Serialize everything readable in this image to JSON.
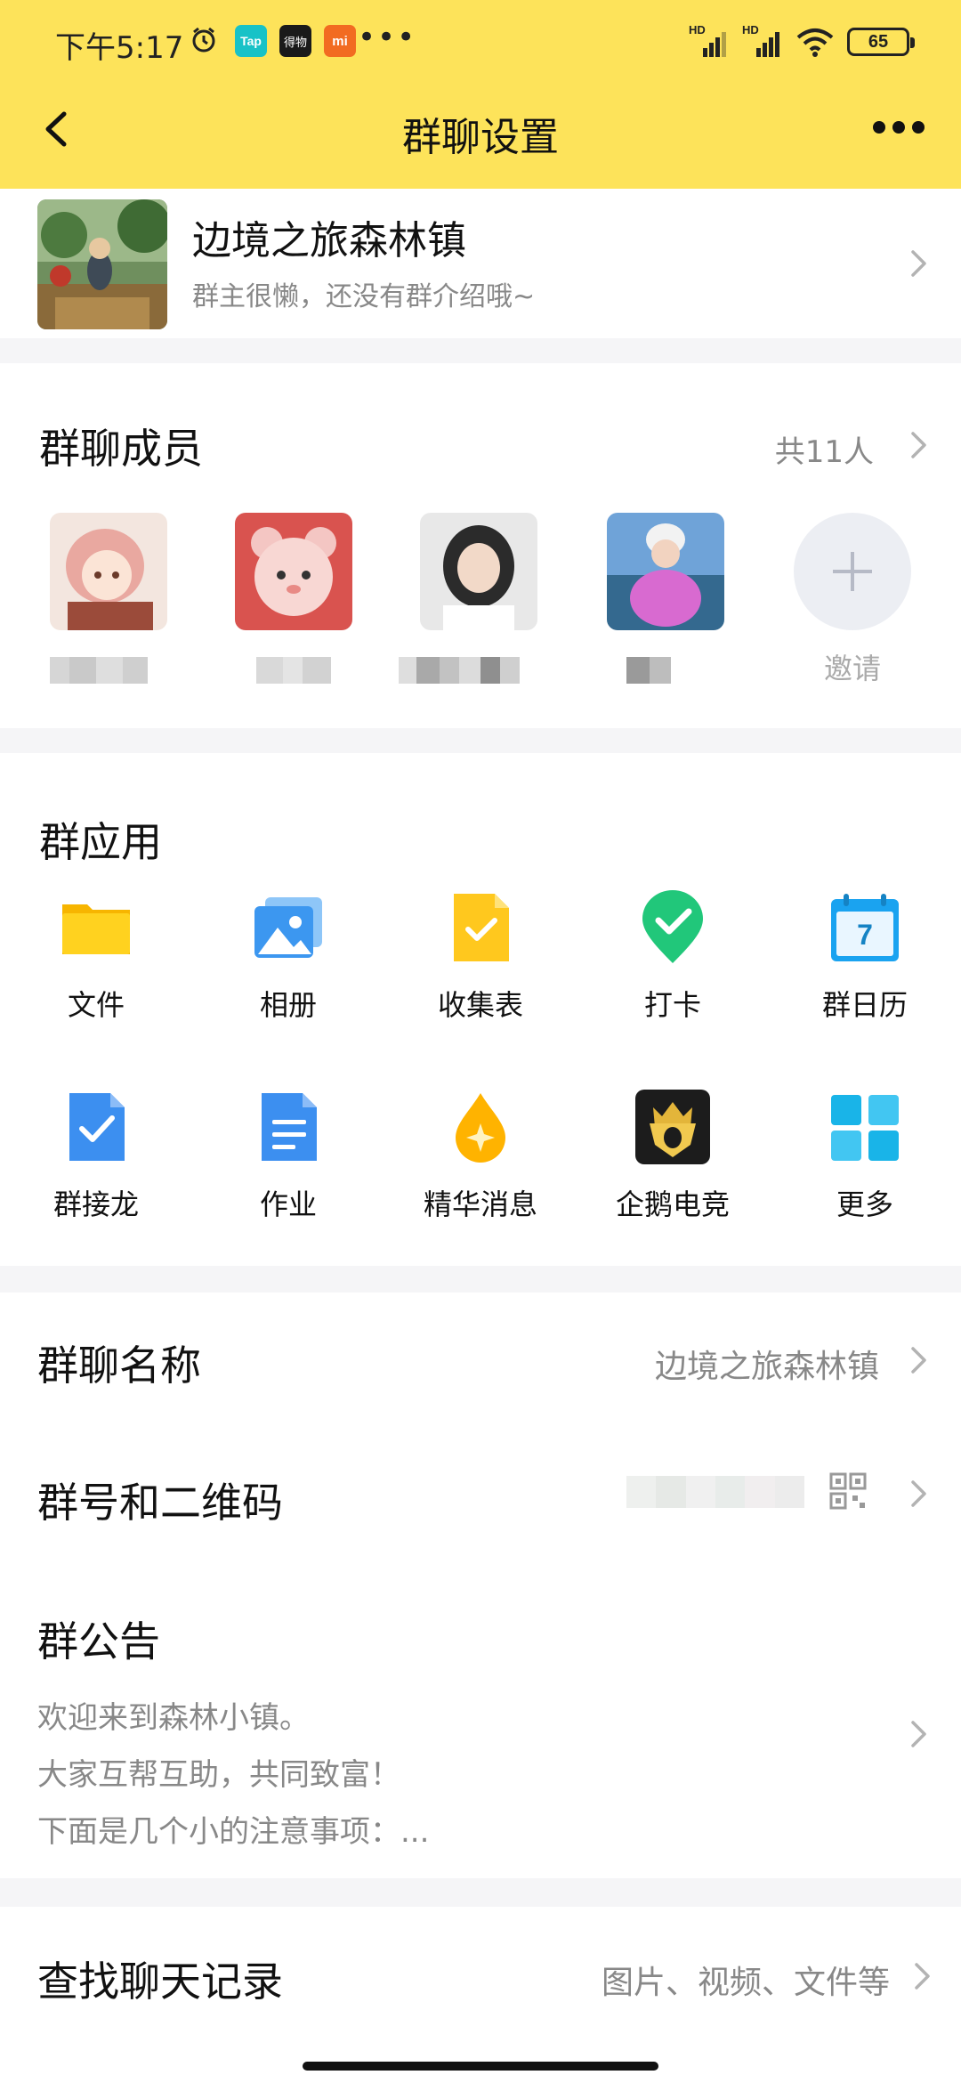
{
  "status": {
    "time": "下午5:17",
    "tap_label": "Tap",
    "dewu_label": "得物",
    "mi_label": "mi",
    "more_dots": "•••",
    "hd1": "HD",
    "hd2": "HD",
    "battery": "65",
    "icons": [
      "alarm-icon",
      "taptap-icon",
      "dewu-icon",
      "xiaomi-icon",
      "signal-icon",
      "wifi-icon",
      "battery-icon"
    ]
  },
  "nav": {
    "title": "群聊设置"
  },
  "group": {
    "name": "边境之旅森林镇",
    "description": "群主很懒，还没有群介绍哦~"
  },
  "members": {
    "title": "群聊成员",
    "count": "共11人",
    "invite_label": "邀请"
  },
  "apps": {
    "title": "群应用",
    "items": [
      {
        "label": "文件",
        "icon": "folder-icon"
      },
      {
        "label": "相册",
        "icon": "album-icon"
      },
      {
        "label": "收集表",
        "icon": "form-icon"
      },
      {
        "label": "打卡",
        "icon": "checkin-icon"
      },
      {
        "label": "群日历",
        "icon": "calendar-icon"
      },
      {
        "label": "群接龙",
        "icon": "relay-icon"
      },
      {
        "label": "作业",
        "icon": "homework-icon"
      },
      {
        "label": "精华消息",
        "icon": "essence-icon"
      },
      {
        "label": "企鹅电竞",
        "icon": "esports-icon"
      },
      {
        "label": "更多",
        "icon": "more-apps-icon"
      }
    ],
    "calendar_day": "7"
  },
  "settings": {
    "name_label": "群聊名称",
    "name_value": "边境之旅森林镇",
    "qr_label": "群号和二维码",
    "notice_label": "群公告",
    "notice_lines": [
      "欢迎来到森林小镇。",
      "大家互帮互助，共同致富！",
      "下面是几个小的注意事项：..."
    ]
  },
  "search": {
    "label": "查找聊天记录",
    "hint": "图片、视频、文件等"
  },
  "colors": {
    "header_bg": "#fde35a",
    "divider": "#f5f5f7",
    "secondary_text": "#888888"
  }
}
